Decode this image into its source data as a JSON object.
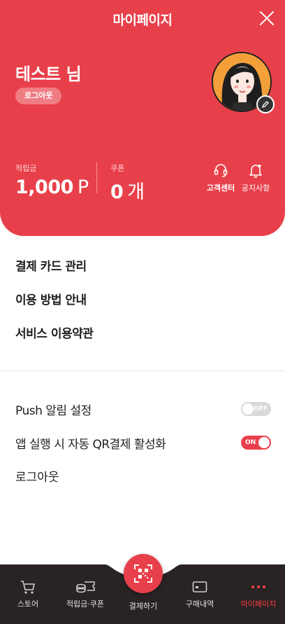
{
  "header": {
    "title": "마이페이지",
    "username": "테스트 님",
    "logout_pill": "로그아웃"
  },
  "stats": {
    "points": {
      "label": "적립금",
      "value": "1,000",
      "unit": "P"
    },
    "coupons": {
      "label": "쿠폰",
      "value": "0",
      "unit": "개"
    }
  },
  "quick_links": [
    {
      "label": "고객센터",
      "icon": "headset-icon"
    },
    {
      "label": "공지사항",
      "icon": "bell-icon"
    }
  ],
  "menu": [
    {
      "label": "결제 카드 관리"
    },
    {
      "label": "이용 방법 안내"
    },
    {
      "label": "서비스 이용약관"
    }
  ],
  "settings": [
    {
      "label": "Push 알림 설정",
      "state": "OFF"
    },
    {
      "label": "앱 실행 시 자동 QR결제 활성화",
      "state": "ON"
    }
  ],
  "logout_row": "로그아웃",
  "bottom_nav": [
    {
      "label": "스토어",
      "icon": "cart-icon"
    },
    {
      "label": "적립금·쿠폰",
      "icon": "coins-icon"
    },
    {
      "label": "결제하기",
      "icon": "qr-scan-icon"
    },
    {
      "label": "구매내역",
      "icon": "card-icon"
    },
    {
      "label": "마이페이지",
      "icon": "more-dots-icon"
    }
  ],
  "colors": {
    "accent": "#e8404a",
    "nav_bg": "#2a2323",
    "active": "#ff3d4a"
  }
}
